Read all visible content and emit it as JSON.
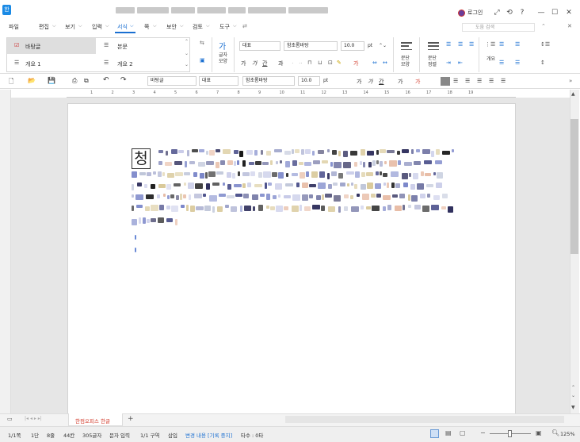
{
  "menu": {
    "items": [
      "파일",
      "편집",
      "보기",
      "입력",
      "서식",
      "쪽",
      "보안",
      "검토",
      "도구"
    ],
    "active": "서식",
    "search_placeholder": "도움 검색"
  },
  "account": {
    "login_label": "로그인"
  },
  "ribbon": {
    "styles": [
      "바탕글",
      "본문",
      "개요 1",
      "개요 2"
    ],
    "font_lang": "대표",
    "font_name": "함초롬바탕",
    "font_size": "10.0",
    "font_unit": "pt",
    "char_shape_label": "글자\n모양",
    "para_shape_label": "문단\n모양",
    "para_label": "문단\n정렬",
    "outline_label": "개요"
  },
  "toolbar": {
    "style_name": "바탕글",
    "font_lang": "대표",
    "font_name": "함초롬바탕",
    "font_size": "10.0",
    "font_unit": "pt"
  },
  "ruler": {
    "ticks": [
      "1",
      "2",
      "3",
      "4",
      "5",
      "6",
      "7",
      "8",
      "9",
      "10",
      "11",
      "12",
      "13",
      "14",
      "15",
      "16",
      "17",
      "18",
      "19"
    ]
  },
  "document": {
    "dropcap": "청"
  },
  "tabs": {
    "doc_tab": "한컴오피스 한글"
  },
  "status": {
    "page": "1/1쪽",
    "section": "1단",
    "line": "8줄",
    "col": "44칸",
    "chars": "305글자",
    "mode": "문자 입력",
    "section_num": "1/1 구역",
    "insert": "삽입",
    "track": "변경 내용 [기록 중지]",
    "count": "타수 : 0타",
    "zoom": "125%"
  },
  "colors": {
    "accent": "#1a6fd1",
    "page_bg": "#ffffff",
    "canvas_bg": "#e6e6e6",
    "tab_red": "#d23a2a"
  }
}
